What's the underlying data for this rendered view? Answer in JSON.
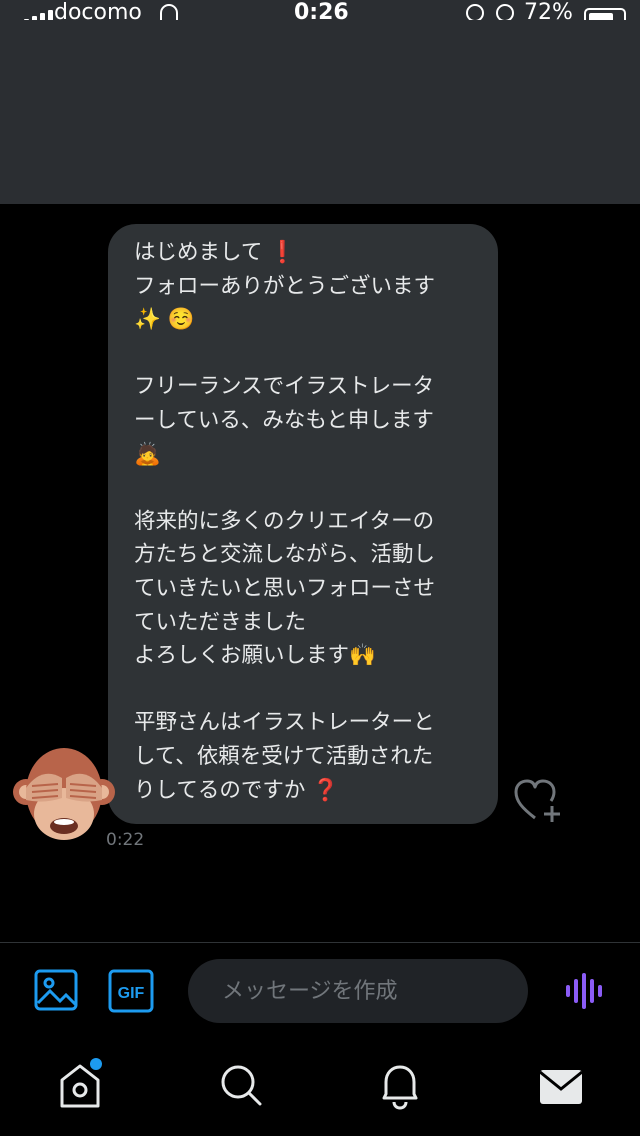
{
  "status_bar": {
    "carrier": "docomo",
    "time": "0:26",
    "battery_percent": "72%"
  },
  "message": {
    "text": "はじめまして ❗️\nフォローありがとうございます\n✨ ☺️\n\nフリーランスでイラストレータ\nーしている、みなもと申します\n🙇\n\n将来的に多くのクリエイターの\n方たちと交流しながら、活動し\nていきたいと思いフォローさせ\nていただきました\nよろしくお願いします🙌\n\n平野さんはイラストレーターと\nして、依頼を受けて活動された\nりしてるのですか ❓",
    "timestamp": "0:22",
    "sender_avatar": "see-no-evil-monkey"
  },
  "composer": {
    "placeholder": "メッセージを作成",
    "gif_label": "GIF"
  },
  "tab_bar": {
    "items": [
      "home",
      "search",
      "notifications",
      "messages"
    ],
    "home_has_notification": true
  },
  "colors": {
    "accent": "#1d9bf0",
    "voice": "#8b5cf6",
    "bubble": "#2f3336",
    "header": "#2b2e32"
  }
}
